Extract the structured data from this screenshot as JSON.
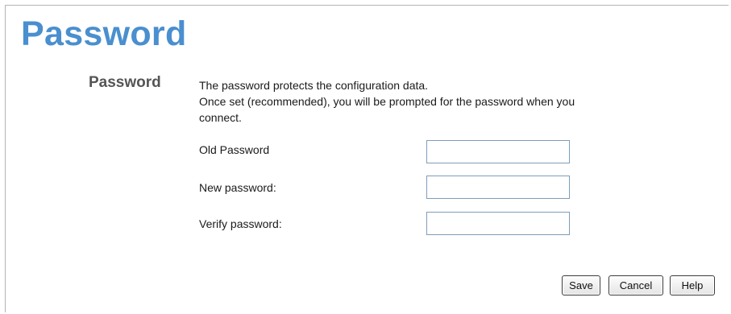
{
  "page": {
    "title": "Password"
  },
  "section": {
    "label": "Password",
    "description_line1": "The password protects the configuration data.",
    "description_line2": "Once set (recommended), you will be prompted for the password when you",
    "description_line3": "connect."
  },
  "fields": {
    "old_password_label": "Old Password",
    "old_password_value": "",
    "new_password_label": "New password:",
    "new_password_value": "",
    "verify_password_label": "Verify password:",
    "verify_password_value": ""
  },
  "buttons": {
    "save_label": "Save",
    "cancel_label": "Cancel",
    "help_label": "Help"
  },
  "colors": {
    "title": "#4a8fcf",
    "section_label": "#555555",
    "input_border": "#7f9db9"
  }
}
